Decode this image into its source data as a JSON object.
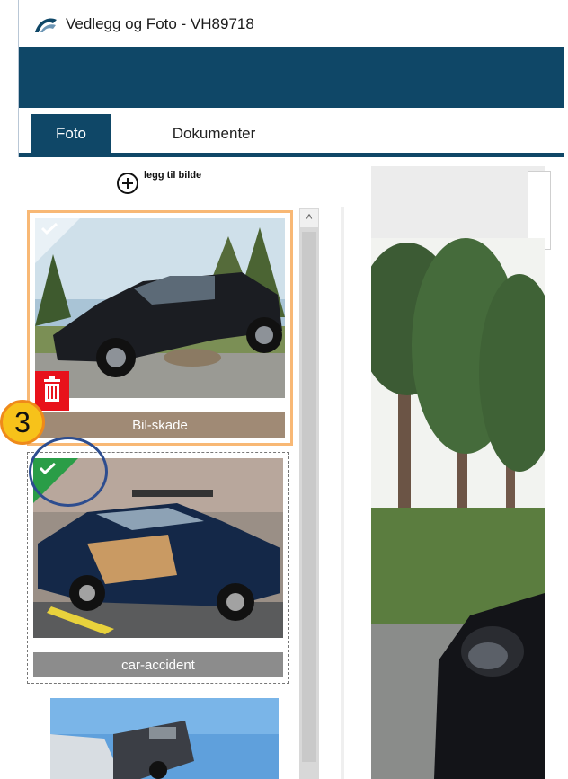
{
  "window": {
    "title": "Vedlegg og Foto - VH89718"
  },
  "tabs": [
    {
      "label": "Foto",
      "active": true
    },
    {
      "label": "Dokumenter",
      "active": false
    }
  ],
  "add_photo": {
    "label": "legg til bilde"
  },
  "photos": [
    {
      "caption": "Bil-skade",
      "selected": true,
      "checked": false
    },
    {
      "caption": "car-accident",
      "selected": false,
      "checked": true
    },
    {
      "caption": "",
      "selected": false,
      "checked": false
    }
  ],
  "annotation": {
    "badge": "3"
  },
  "colors": {
    "brand": "#0f4767",
    "selected_border": "#f8b875",
    "delete": "#e8121b",
    "check": "#2a9d47",
    "badge": "#f7c21a",
    "ring": "#2d4d8f"
  }
}
